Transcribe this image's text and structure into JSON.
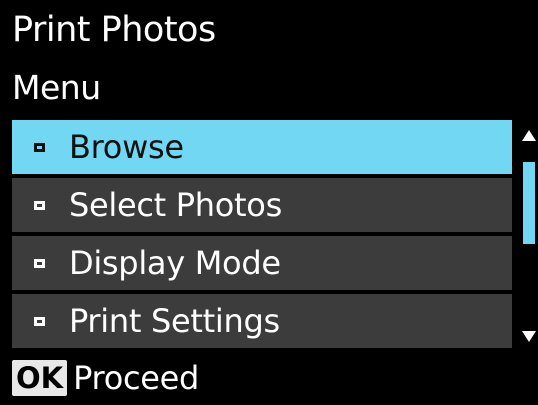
{
  "header": {
    "title": "Print Photos",
    "subtitle": "Menu"
  },
  "menu": {
    "items": [
      {
        "label": "Browse",
        "selected": true
      },
      {
        "label": "Select Photos",
        "selected": false
      },
      {
        "label": "Display Mode",
        "selected": false
      },
      {
        "label": "Print Settings",
        "selected": false
      }
    ]
  },
  "footer": {
    "key_label": "OK",
    "action_label": "Proceed"
  },
  "colors": {
    "background": "#000000",
    "highlight": "#71d7f3",
    "item_background": "#3c3c3c",
    "text": "#ffffff"
  }
}
